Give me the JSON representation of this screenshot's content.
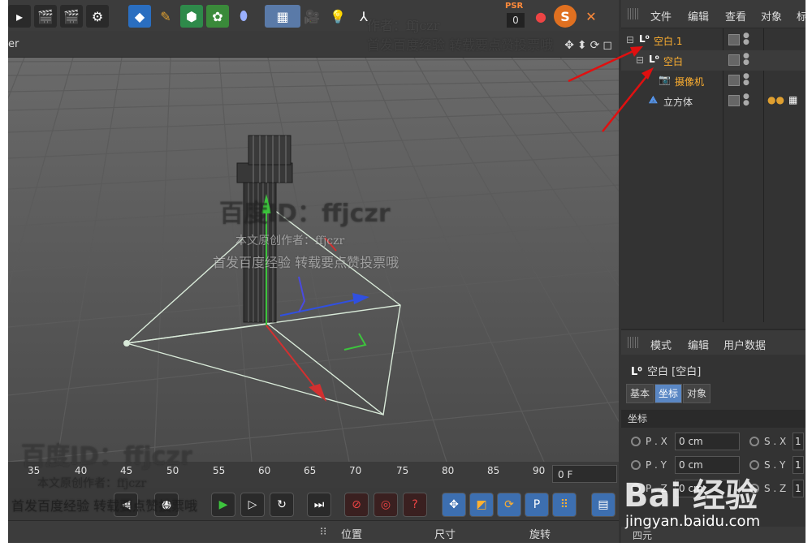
{
  "viewport": {
    "label": "er"
  },
  "toolbar": {
    "psr_label": "PSR",
    "psr_value": "0"
  },
  "timeline": {
    "ticks": [
      "35",
      "40",
      "45",
      "50",
      "55",
      "60",
      "65",
      "70",
      "75",
      "80",
      "85",
      "90"
    ],
    "current_frame": "0 F"
  },
  "bottom_bar": {
    "position": "位置",
    "size": "尺寸",
    "rotation": "旋转"
  },
  "object_manager": {
    "menu": [
      "文件",
      "编辑",
      "查看",
      "对象",
      "标"
    ],
    "objects": [
      {
        "name": "空白.1",
        "icon": "L0"
      },
      {
        "name": "空白",
        "icon": "L0"
      },
      {
        "name": "摄像机",
        "icon": "camera"
      },
      {
        "name": "立方体",
        "icon": "cube"
      }
    ]
  },
  "attributes": {
    "menu": [
      "模式",
      "编辑",
      "用户数据"
    ],
    "title": "空白 [空白]",
    "tabs": [
      "基本",
      "坐标",
      "对象"
    ],
    "active_tab": "坐标",
    "section": "坐标",
    "rows": [
      {
        "label": "P . X",
        "value": "0 cm",
        "label2": "S . X",
        "value2": "1"
      },
      {
        "label": "P . Y",
        "value": "0 cm",
        "label2": "S . Y",
        "value2": "1"
      },
      {
        "label": "P . Z",
        "value": "0 cm",
        "label2": "S . Z",
        "value2": "1"
      }
    ],
    "subsection": "四元"
  },
  "watermarks": {
    "id_line": "百度ID：ffjczr",
    "author_line": "本文原创作者：ffjczr",
    "repost_line": "首发百度经验  转载要点赞投票哦",
    "top_author": "作者：ffjczr",
    "baidu_logo": "Bai 经验",
    "baidu_url": "jingyan.baidu.com"
  }
}
